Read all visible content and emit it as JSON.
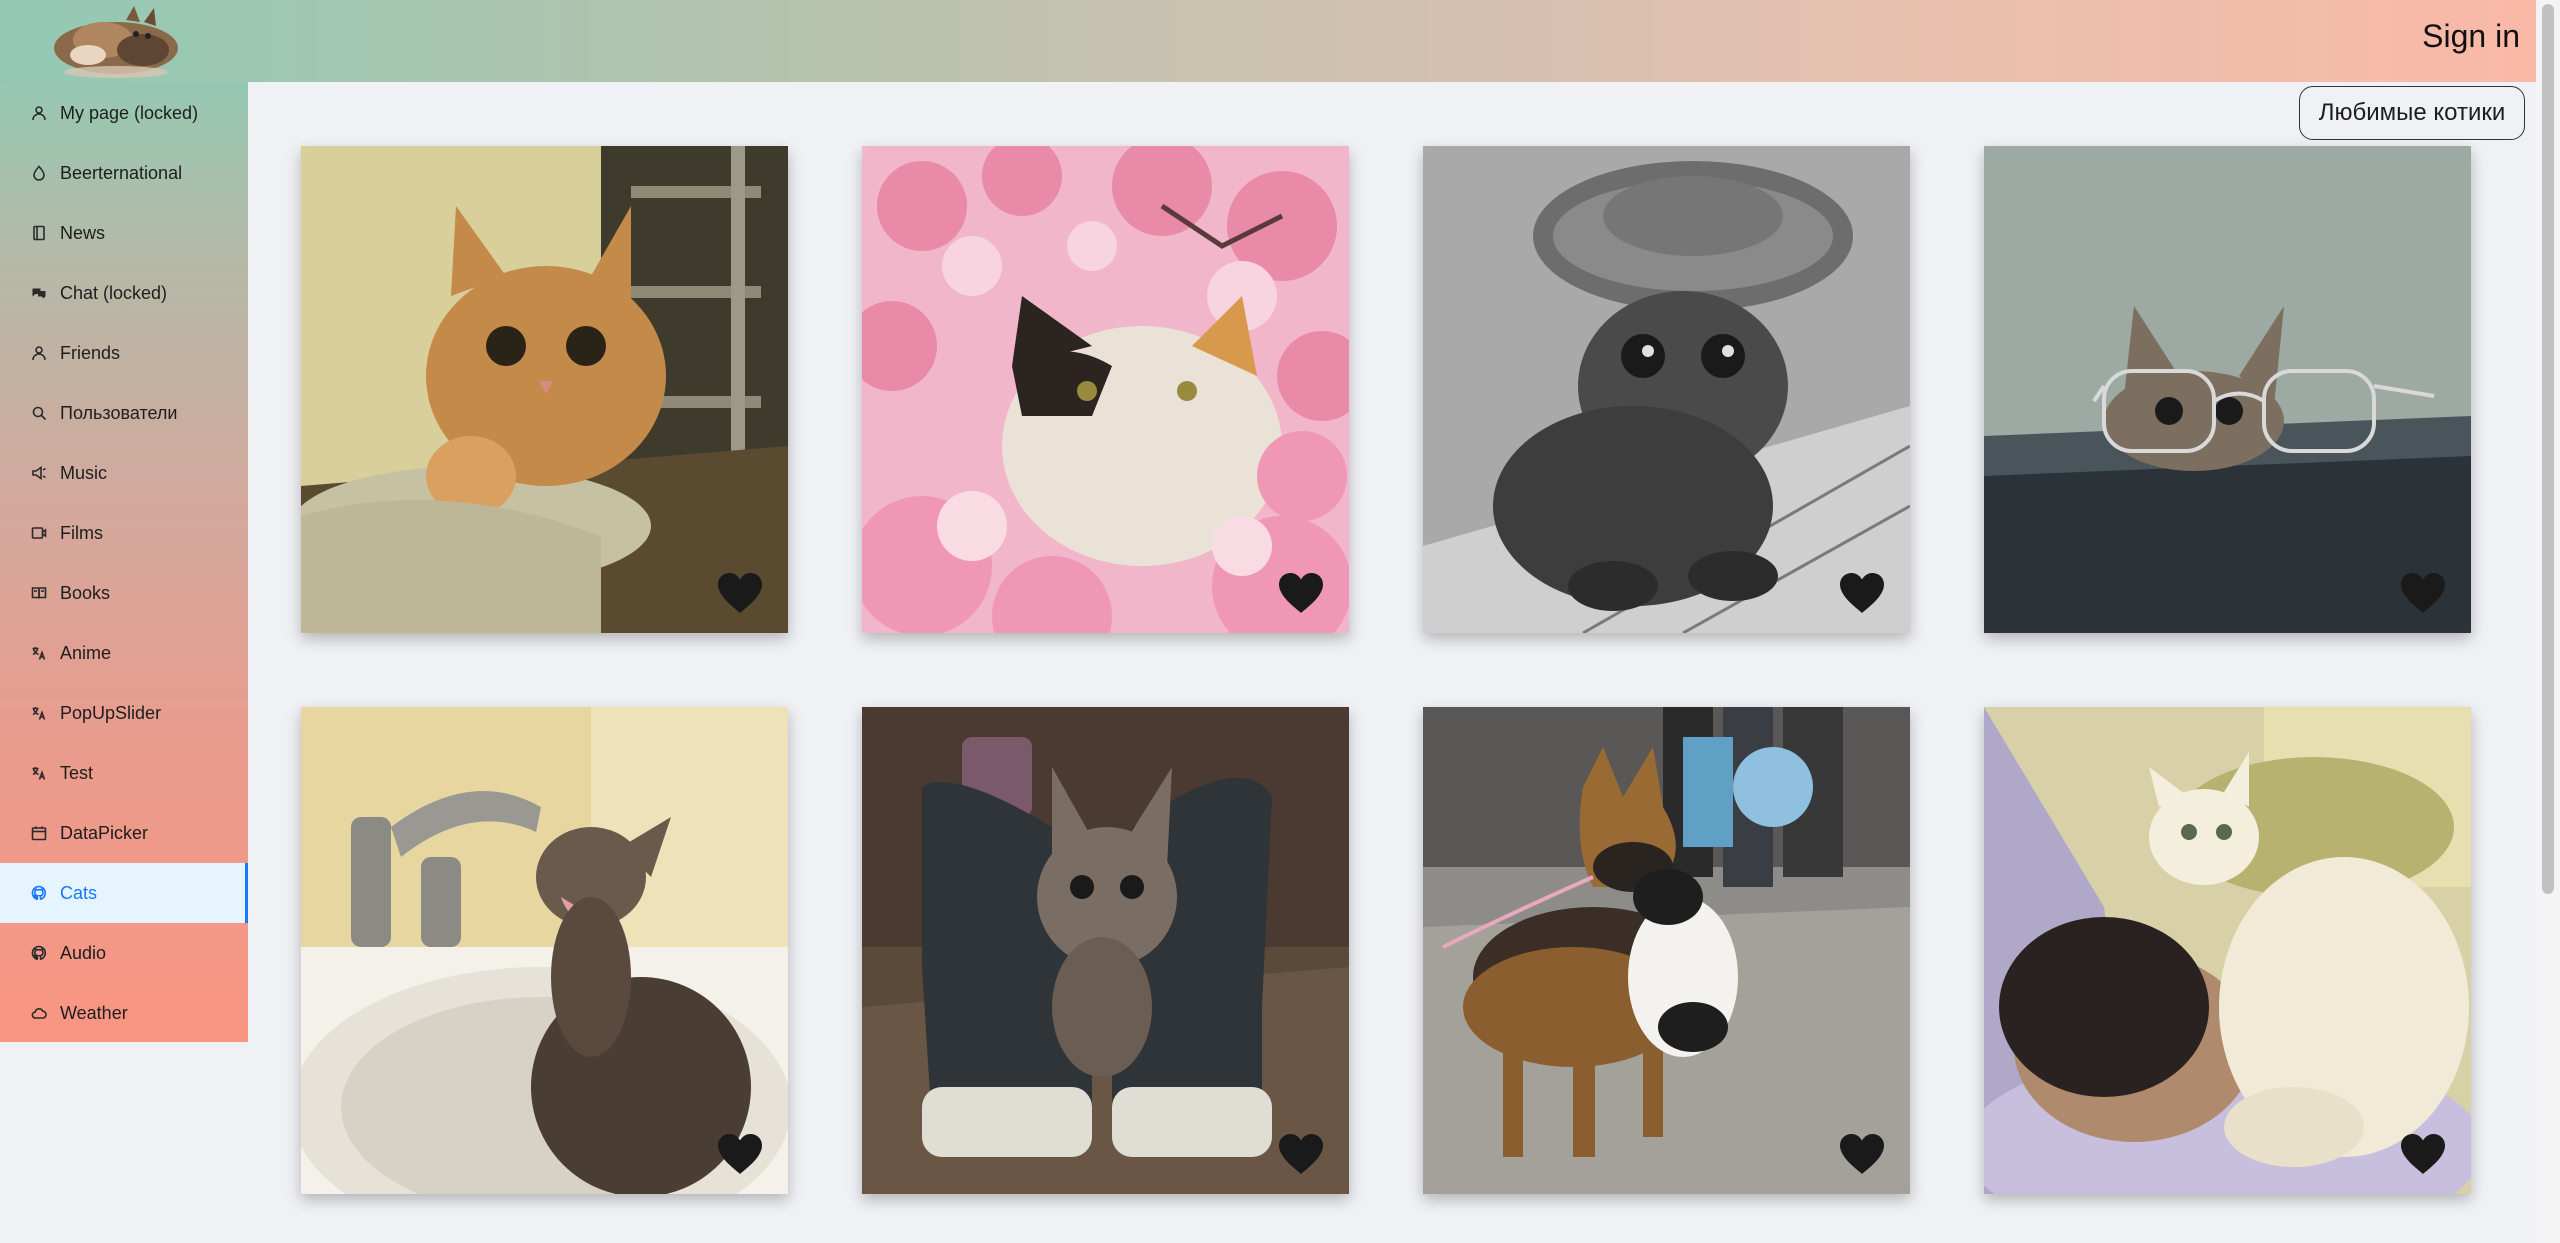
{
  "header": {
    "sign_in_label": "Sign in"
  },
  "sidebar": {
    "items": [
      {
        "label": "My page (locked)",
        "icon": "user-icon"
      },
      {
        "label": "Beerternational",
        "icon": "droplet-icon"
      },
      {
        "label": "News",
        "icon": "book-icon"
      },
      {
        "label": "Chat (locked)",
        "icon": "chat-icon"
      },
      {
        "label": "Friends",
        "icon": "user-icon"
      },
      {
        "label": "Пользователи",
        "icon": "search-icon"
      },
      {
        "label": "Music",
        "icon": "sound-icon"
      },
      {
        "label": "Films",
        "icon": "video-icon"
      },
      {
        "label": "Books",
        "icon": "read-icon"
      },
      {
        "label": "Anime",
        "icon": "translate-icon"
      },
      {
        "label": "PopUpSlider",
        "icon": "translate-icon"
      },
      {
        "label": "Test",
        "icon": "translate-icon"
      },
      {
        "label": "DataPicker",
        "icon": "calendar-icon"
      },
      {
        "label": "Cats",
        "icon": "github-icon",
        "active": true
      },
      {
        "label": "Audio",
        "icon": "github-icon"
      },
      {
        "label": "Weather",
        "icon": "cloud-icon"
      }
    ]
  },
  "favorites_button_label": "Любимые котики",
  "colors": {
    "active_blue": "#1677ff",
    "active_bg": "#e6f4ff",
    "heart": "#1a1a1a"
  },
  "cards": [
    {
      "subject": "orange tabby cat in basket"
    },
    {
      "subject": "calico cat in pink blossoms"
    },
    {
      "subject": "kitten in sombrero, black and white"
    },
    {
      "subject": "cat peeking behind glasses"
    },
    {
      "subject": "kitten drinking from faucet"
    },
    {
      "subject": "kitten in sneakers"
    },
    {
      "subject": "dog carrying kitten"
    },
    {
      "subject": "white cat hugging man"
    }
  ]
}
